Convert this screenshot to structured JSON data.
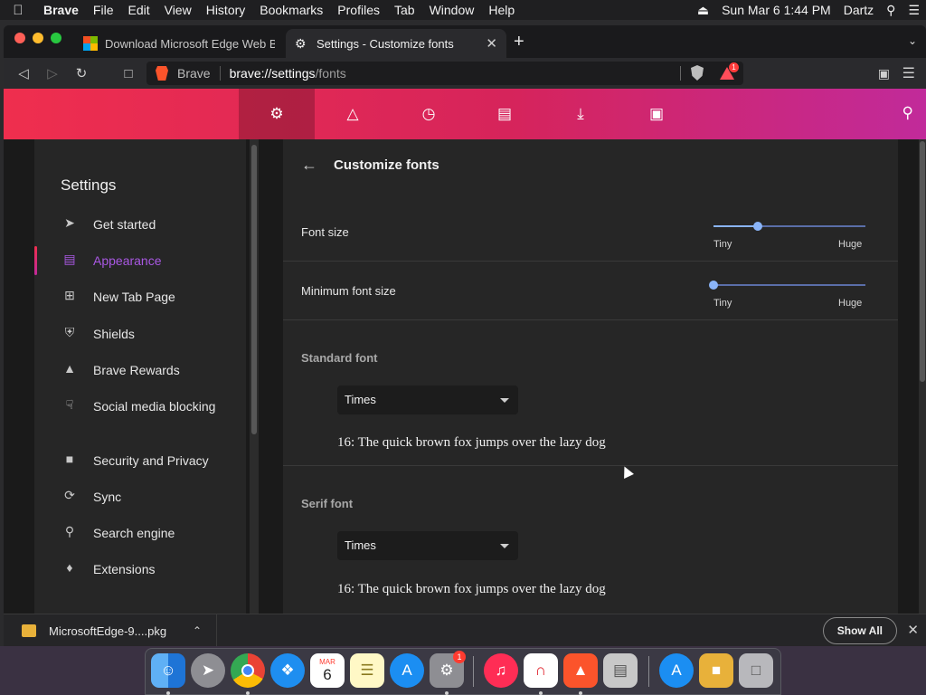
{
  "menubar": {
    "app_name": "Brave",
    "items": [
      "File",
      "Edit",
      "View",
      "History",
      "Bookmarks",
      "Profiles",
      "Tab",
      "Window",
      "Help"
    ],
    "datetime": "Sun Mar 6  1:44 PM",
    "user": "Dartz"
  },
  "tabs": [
    {
      "title": "Download Microsoft Edge Web Brow",
      "favicon": "microsoft-logo-icon"
    },
    {
      "title": "Settings - Customize fonts",
      "favicon": "gear-icon"
    }
  ],
  "address_bar": {
    "brand": "Brave",
    "url_host": "brave://settings",
    "url_path": "/fonts"
  },
  "toolbar": {
    "rewards_badge": "1"
  },
  "settings_nav": {
    "title": "Settings",
    "active_index": 1,
    "accent": "#a958e3",
    "items": [
      {
        "label": "Get started",
        "icon": "rocket-icon"
      },
      {
        "label": "Appearance",
        "icon": "appearance-icon"
      },
      {
        "label": "New Tab Page",
        "icon": "new-tab-icon"
      },
      {
        "label": "Shields",
        "icon": "shield-icon"
      },
      {
        "label": "Brave Rewards",
        "icon": "rewards-triangle-icon"
      },
      {
        "label": "Social media blocking",
        "icon": "thumbs-down-icon"
      },
      {
        "label": "Security and Privacy",
        "icon": "lock-icon"
      },
      {
        "label": "Sync",
        "icon": "sync-icon"
      },
      {
        "label": "Search engine",
        "icon": "search-engine-icon"
      },
      {
        "label": "Extensions",
        "icon": "puzzle-icon"
      }
    ]
  },
  "page": {
    "title": "Customize fonts",
    "font_size": {
      "label": "Font size",
      "min_label": "Tiny",
      "max_label": "Huge",
      "value_fraction": 0.29
    },
    "min_font_size": {
      "label": "Minimum font size",
      "min_label": "Tiny",
      "max_label": "Huge",
      "value_fraction": 0.0
    },
    "standard_font": {
      "label": "Standard font",
      "value": "Times",
      "sample": "16: The quick brown fox jumps over the lazy dog"
    },
    "serif_font": {
      "label": "Serif font",
      "value": "Times",
      "sample": "16: The quick brown fox jumps over the lazy dog"
    }
  },
  "downloads": {
    "file_name": "MicrosoftEdge-9....pkg",
    "show_all": "Show All"
  },
  "dock": {
    "calendar_month": "MAR",
    "calendar_day": "6",
    "system_prefs_badge": "1",
    "apps": [
      "Finder",
      "Launchpad",
      "Chrome",
      "Safari",
      "Calendar",
      "Notes",
      "App Store",
      "System Preferences",
      "Music",
      "Magnet",
      "Brave",
      "Archive Utility",
      "App Store",
      "Package",
      "Trash"
    ]
  }
}
